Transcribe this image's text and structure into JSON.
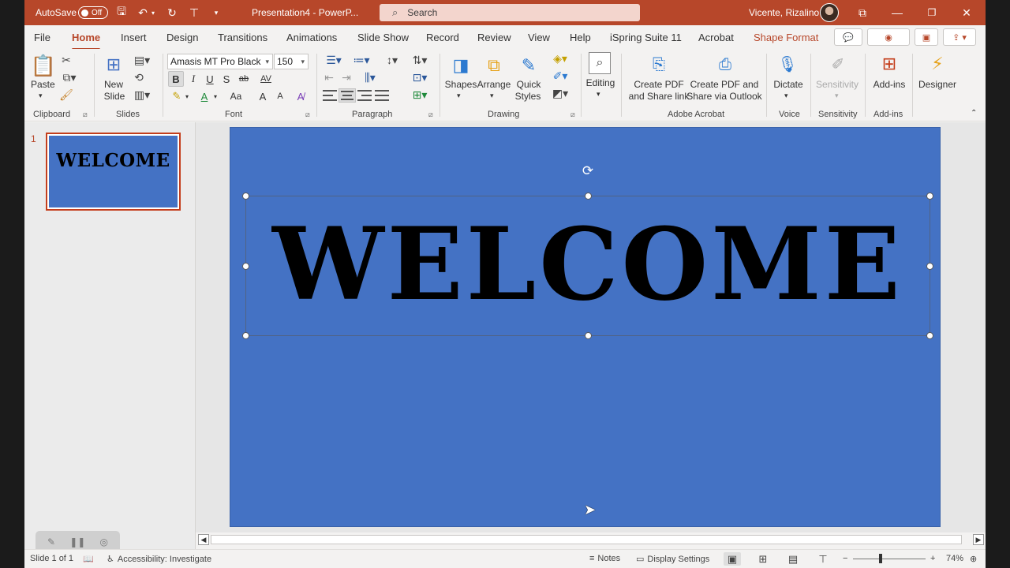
{
  "titlebar": {
    "autosave_label": "AutoSave",
    "autosave_state": "Off",
    "doc_title": "Presentation4  -  PowerP...",
    "search_placeholder": "Search",
    "user_name": "Vicente, Rizalino"
  },
  "tabs": [
    "File",
    "Home",
    "Insert",
    "Design",
    "Transitions",
    "Animations",
    "Slide Show",
    "Record",
    "Review",
    "View",
    "Help",
    "iSpring Suite 11",
    "Acrobat",
    "Shape Format"
  ],
  "active_tab": "Home",
  "ribbon": {
    "clipboard": {
      "paste": "Paste",
      "label": "Clipboard"
    },
    "slides": {
      "new_slide_1": "New",
      "new_slide_2": "Slide",
      "label": "Slides"
    },
    "font": {
      "font_name": "Amasis MT Pro Black",
      "font_size": "150",
      "label": "Font",
      "bold": "B",
      "italic": "I",
      "underline": "U",
      "strike": "S",
      "strike2": "ab",
      "spacing": "AV",
      "case": "Aa",
      "grow": "A",
      "shrink": "A"
    },
    "paragraph": {
      "label": "Paragraph"
    },
    "drawing": {
      "shapes": "Shapes",
      "arrange": "Arrange",
      "quick_1": "Quick",
      "quick_2": "Styles",
      "label": "Drawing"
    },
    "editing": {
      "label": "Editing"
    },
    "acrobat": {
      "pdf_share_1": "Create PDF",
      "pdf_share_2": "and Share link",
      "pdf_outlook_1": "Create PDF and",
      "pdf_outlook_2": "Share via Outlook",
      "label": "Adobe Acrobat"
    },
    "voice": {
      "dictate": "Dictate",
      "label": "Voice"
    },
    "sensitivity": {
      "btn": "Sensitivity",
      "label": "Sensitivity"
    },
    "addins": {
      "btn": "Add-ins",
      "label": "Add-ins"
    },
    "designer": {
      "btn": "Designer"
    }
  },
  "thumbnails": [
    {
      "number": "1",
      "text": "WELCOME"
    }
  ],
  "slide": {
    "title_text": "WELCOME",
    "background": "#4472c4"
  },
  "statusbar": {
    "slide_count": "Slide 1 of 1",
    "accessibility": "Accessibility: Investigate",
    "notes": "Notes",
    "display_settings": "Display Settings",
    "zoom_level": "74%"
  },
  "colors": {
    "accent": "#b7472a",
    "slide_bg": "#4472c4"
  }
}
